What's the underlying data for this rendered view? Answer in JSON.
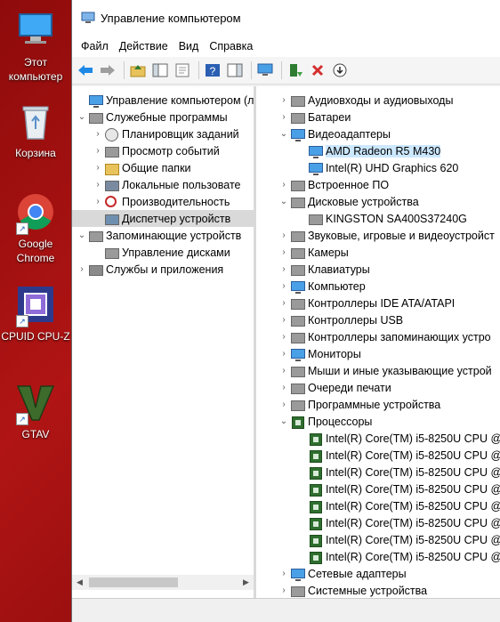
{
  "desktop": {
    "icons": [
      {
        "label": "Этот компьютер",
        "icon": "this-pc-icon"
      },
      {
        "label": "Корзина",
        "icon": "recycle-bin-icon"
      },
      {
        "label": "Google Chrome",
        "icon": "chrome-icon"
      },
      {
        "label": "CPUID CPU-Z",
        "icon": "cpuz-icon"
      },
      {
        "label": "GTAV",
        "icon": "gtav-icon"
      }
    ]
  },
  "window": {
    "title": "Управление компьютером",
    "menu": [
      "Файл",
      "Действие",
      "Вид",
      "Справка"
    ],
    "toolbar": [
      "back-icon",
      "forward-icon",
      "up-icon",
      "show-hide-tree-icon",
      "properties-icon",
      "help-icon",
      "show-hide-action-icon",
      "monitor-icon",
      "update-driver-icon",
      "uninstall-icon",
      "download-icon"
    ]
  },
  "left_tree": [
    {
      "label": "Управление компьютером (лс",
      "level": 0,
      "expander": "",
      "icon": "computer-management-icon"
    },
    {
      "label": "Служебные программы",
      "level": 1,
      "expander": "⌄",
      "icon": "tools-icon"
    },
    {
      "label": "Планировщик заданий",
      "level": 2,
      "expander": "›",
      "icon": "clock-icon"
    },
    {
      "label": "Просмотр событий",
      "level": 2,
      "expander": "›",
      "icon": "event-viewer-icon"
    },
    {
      "label": "Общие папки",
      "level": 2,
      "expander": "›",
      "icon": "shared-folder-icon"
    },
    {
      "label": "Локальные пользовате",
      "level": 2,
      "expander": "›",
      "icon": "users-icon"
    },
    {
      "label": "Производительность",
      "level": 2,
      "expander": "›",
      "icon": "performance-icon"
    },
    {
      "label": "Диспетчер устройств",
      "level": 2,
      "expander": "",
      "icon": "device-manager-icon",
      "selected": true
    },
    {
      "label": "Запоминающие устройств",
      "level": 1,
      "expander": "⌄",
      "icon": "storage-icon"
    },
    {
      "label": "Управление дисками",
      "level": 2,
      "expander": "",
      "icon": "disk-management-icon"
    },
    {
      "label": "Службы и приложения",
      "level": 1,
      "expander": "›",
      "icon": "services-icon"
    }
  ],
  "right_tree": [
    {
      "label": "Аудиовходы и аудиовыходы",
      "level": 0,
      "expander": "›",
      "icon": "audio-icon"
    },
    {
      "label": "Батареи",
      "level": 0,
      "expander": "›",
      "icon": "battery-icon"
    },
    {
      "label": "Видеоадаптеры",
      "level": 0,
      "expander": "⌄",
      "icon": "display-adapter-icon"
    },
    {
      "label": "AMD Radeon R5 M430",
      "level": 1,
      "expander": "",
      "icon": "display-adapter-icon",
      "selected": true
    },
    {
      "label": "Intel(R) UHD Graphics 620",
      "level": 1,
      "expander": "",
      "icon": "display-adapter-icon"
    },
    {
      "label": "Встроенное ПО",
      "level": 0,
      "expander": "›",
      "icon": "firmware-icon"
    },
    {
      "label": "Дисковые устройства",
      "level": 0,
      "expander": "⌄",
      "icon": "disk-drive-icon"
    },
    {
      "label": "KINGSTON SA400S37240G",
      "level": 1,
      "expander": "",
      "icon": "disk-drive-icon"
    },
    {
      "label": "Звуковые, игровые и видеоустройст",
      "level": 0,
      "expander": "›",
      "icon": "sound-icon"
    },
    {
      "label": "Камеры",
      "level": 0,
      "expander": "›",
      "icon": "camera-icon"
    },
    {
      "label": "Клавиатуры",
      "level": 0,
      "expander": "›",
      "icon": "keyboard-icon"
    },
    {
      "label": "Компьютер",
      "level": 0,
      "expander": "›",
      "icon": "computer-icon"
    },
    {
      "label": "Контроллеры IDE ATA/ATAPI",
      "level": 0,
      "expander": "›",
      "icon": "ide-controller-icon"
    },
    {
      "label": "Контроллеры USB",
      "level": 0,
      "expander": "›",
      "icon": "usb-icon"
    },
    {
      "label": "Контроллеры запоминающих устро",
      "level": 0,
      "expander": "›",
      "icon": "storage-controller-icon"
    },
    {
      "label": "Мониторы",
      "level": 0,
      "expander": "›",
      "icon": "monitor-icon"
    },
    {
      "label": "Мыши и иные указывающие устрой",
      "level": 0,
      "expander": "›",
      "icon": "mouse-icon"
    },
    {
      "label": "Очереди печати",
      "level": 0,
      "expander": "›",
      "icon": "printer-icon"
    },
    {
      "label": "Программные устройства",
      "level": 0,
      "expander": "›",
      "icon": "software-device-icon"
    },
    {
      "label": "Процессоры",
      "level": 0,
      "expander": "⌄",
      "icon": "processor-icon"
    },
    {
      "label": "Intel(R) Core(TM) i5-8250U CPU @",
      "level": 1,
      "expander": "",
      "icon": "processor-icon"
    },
    {
      "label": "Intel(R) Core(TM) i5-8250U CPU @",
      "level": 1,
      "expander": "",
      "icon": "processor-icon"
    },
    {
      "label": "Intel(R) Core(TM) i5-8250U CPU @",
      "level": 1,
      "expander": "",
      "icon": "processor-icon"
    },
    {
      "label": "Intel(R) Core(TM) i5-8250U CPU @",
      "level": 1,
      "expander": "",
      "icon": "processor-icon"
    },
    {
      "label": "Intel(R) Core(TM) i5-8250U CPU @",
      "level": 1,
      "expander": "",
      "icon": "processor-icon"
    },
    {
      "label": "Intel(R) Core(TM) i5-8250U CPU @",
      "level": 1,
      "expander": "",
      "icon": "processor-icon"
    },
    {
      "label": "Intel(R) Core(TM) i5-8250U CPU @",
      "level": 1,
      "expander": "",
      "icon": "processor-icon"
    },
    {
      "label": "Intel(R) Core(TM) i5-8250U CPU @",
      "level": 1,
      "expander": "",
      "icon": "processor-icon"
    },
    {
      "label": "Сетевые адаптеры",
      "level": 0,
      "expander": "›",
      "icon": "network-adapter-icon"
    },
    {
      "label": "Системные устройства",
      "level": 0,
      "expander": "›",
      "icon": "system-device-icon"
    }
  ]
}
